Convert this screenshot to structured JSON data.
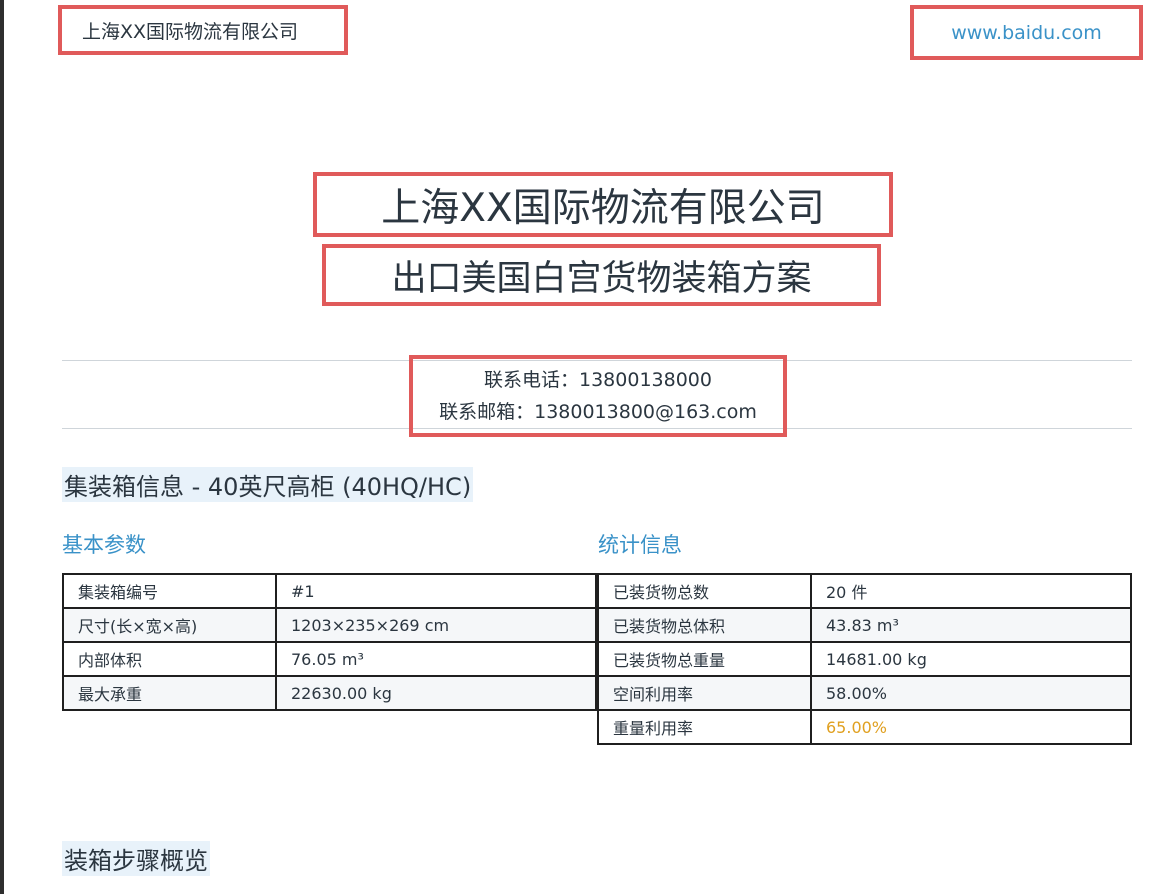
{
  "header": {
    "company": "上海XX国际物流有限公司",
    "website": "www.baidu.com"
  },
  "title": {
    "company": "上海XX国际物流有限公司",
    "plan": "出口美国白宫货物装箱方案"
  },
  "contact": {
    "phone": "联系电话：13800138000",
    "email": "联系邮箱：1380013800@163.com"
  },
  "container_section": {
    "title": "集装箱信息 - 40英尺高柜 (40HQ/HC)",
    "basic": {
      "title": "基本参数",
      "rows": [
        {
          "label": "集装箱编号",
          "value": "#1"
        },
        {
          "label": "尺寸(长×宽×高)",
          "value": "1203×235×269 cm"
        },
        {
          "label": "内部体积",
          "value": "76.05 m³"
        },
        {
          "label": "最大承重",
          "value": "22630.00 kg"
        }
      ]
    },
    "stats": {
      "title": "统计信息",
      "rows": [
        {
          "label": "已装货物总数",
          "value": "20 件"
        },
        {
          "label": "已装货物总体积",
          "value": "43.83 m³"
        },
        {
          "label": "已装货物总重量",
          "value": "14681.00 kg"
        },
        {
          "label": "空间利用率",
          "value": "58.00%"
        },
        {
          "label": "重量利用率",
          "value": "65.00%"
        }
      ]
    }
  },
  "steps_section": {
    "title": "装箱步骤概览"
  },
  "colors": {
    "accent": "#3a92c8",
    "highlight": "#e0a020",
    "annotation_box": "#e05a5a"
  }
}
